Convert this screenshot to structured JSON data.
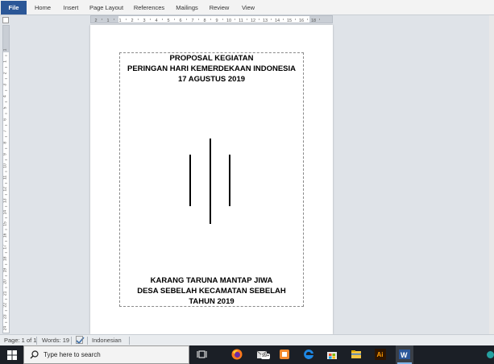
{
  "ribbon": {
    "tabs": [
      "File",
      "Home",
      "Insert",
      "Page Layout",
      "References",
      "Mailings",
      "Review",
      "View"
    ]
  },
  "ruler": {
    "h_labels": [
      "2",
      "1",
      "1",
      "2",
      "3",
      "4",
      "5",
      "6",
      "7",
      "8",
      "9",
      "10",
      "11",
      "12",
      "13",
      "14",
      "15",
      "16",
      "18"
    ],
    "v_labels": [
      "1",
      "1",
      "2",
      "3",
      "4",
      "5",
      "6",
      "7",
      "8",
      "9",
      "10",
      "11",
      "12",
      "13",
      "14",
      "15",
      "16",
      "17",
      "18",
      "19",
      "20",
      "21",
      "22",
      "23",
      "24"
    ]
  },
  "document": {
    "title_lines": [
      "PROPOSAL KEGIATAN",
      "PERINGAN HARI KEMERDEKAAN INDONESIA",
      "17 AGUSTUS 2019"
    ],
    "footer_lines": [
      "KARANG TARUNA MANTAP JIWA",
      "DESA SEBELAH KECAMATAN SEBELAH",
      "TAHUN 2019"
    ]
  },
  "statusbar": {
    "page": "Page: 1 of 1",
    "words": "Words: 19",
    "language": "Indonesian"
  },
  "taskbar": {
    "search_placeholder": "Type here to search",
    "badge": "99+",
    "apps": [
      "task-view-icon",
      "firefox-icon",
      "mail-icon",
      "files-icon",
      "edge-icon",
      "store-icon",
      "file-explorer-icon",
      "illustrator-icon",
      "word-icon"
    ]
  },
  "colors": {
    "file_tab": "#2b5797",
    "taskbar": "#1b1f26",
    "word_blue": "#2b579a",
    "active_indicator": "#7fb4e8"
  }
}
